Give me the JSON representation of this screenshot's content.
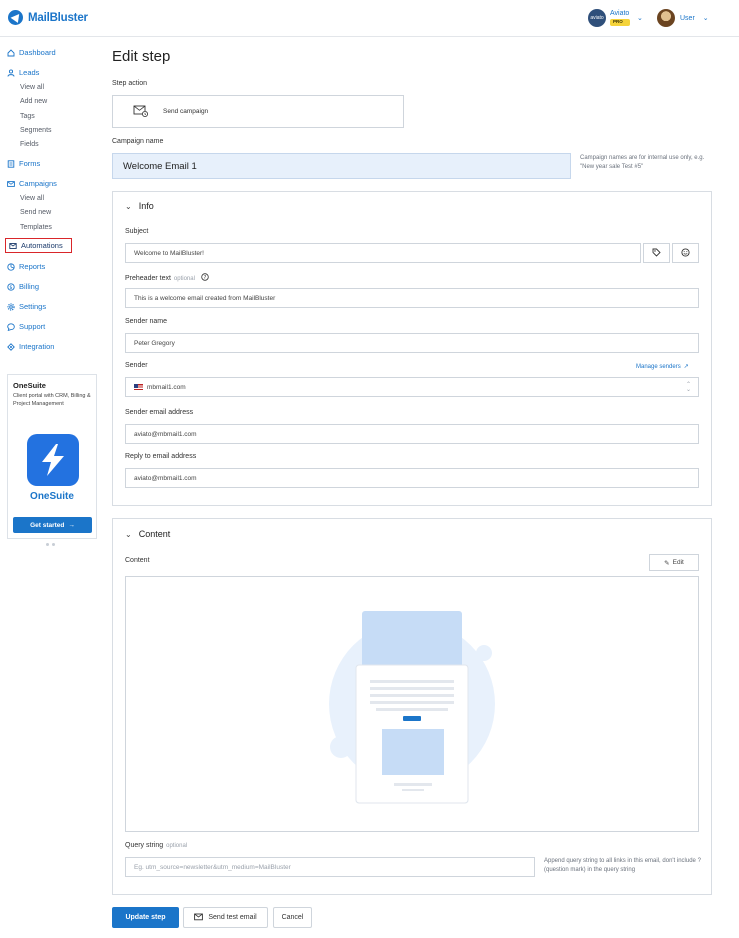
{
  "brand": {
    "name": "MailBluster"
  },
  "account": {
    "name": "Aviato",
    "plan": "PRO",
    "avatar_text": "aviato"
  },
  "user": {
    "name": "User"
  },
  "sidebar": {
    "dashboard": "Dashboard",
    "leads": "Leads",
    "leads_sub": [
      "View all",
      "Add new",
      "Tags",
      "Segments",
      "Fields"
    ],
    "forms": "Forms",
    "campaigns": "Campaigns",
    "campaigns_sub": [
      "View all",
      "Send new",
      "Templates"
    ],
    "automations": "Automations",
    "reports": "Reports",
    "billing": "Billing",
    "settings": "Settings",
    "support": "Support",
    "integration": "Integration"
  },
  "promo": {
    "title": "OneSuite",
    "description": "Client portal with CRM, Billing & Project Management",
    "brand": "OneSuite",
    "cta": "Get started"
  },
  "page": {
    "title": "Edit step",
    "step_action_label": "Step action",
    "step_action_value": "Send campaign",
    "campaign_name_label": "Campaign name",
    "campaign_name_value": "Welcome Email 1",
    "campaign_name_hint": "Campaign names are for internal use only, e.g. \"New year sale Test #5\""
  },
  "info": {
    "title": "Info",
    "subject_label": "Subject",
    "subject_value": "Welcome  to MailBluster!",
    "preheader_label": "Preheader text",
    "preheader_optional": "optional",
    "preheader_value": "This is a welcome email created from MailBluster",
    "sender_name_label": "Sender name",
    "sender_name_value": "Peter Gregory",
    "sender_label": "Sender",
    "manage_senders": "Manage senders",
    "sender_value": "mbmail1.com",
    "sender_email_label": "Sender email address",
    "sender_email_value": "aviato@mbmail1.com",
    "reply_to_label": "Reply to email address",
    "reply_to_value": "aviato@mbmail1.com"
  },
  "content": {
    "title": "Content",
    "content_label": "Content",
    "edit_button": "Edit",
    "query_label": "Query string",
    "query_optional": "optional",
    "query_placeholder": "Eg. utm_source=newsletter&utm_medium=MailBluster",
    "query_hint": "Append query string to all links in this email, don't include ? (question mark) in the query string"
  },
  "actions": {
    "update": "Update step",
    "send_test": "Send test email",
    "cancel": "Cancel"
  },
  "colors": {
    "accent": "#1b75c9",
    "highlight": "#d9262a",
    "input_fill": "#e7f0fb"
  }
}
